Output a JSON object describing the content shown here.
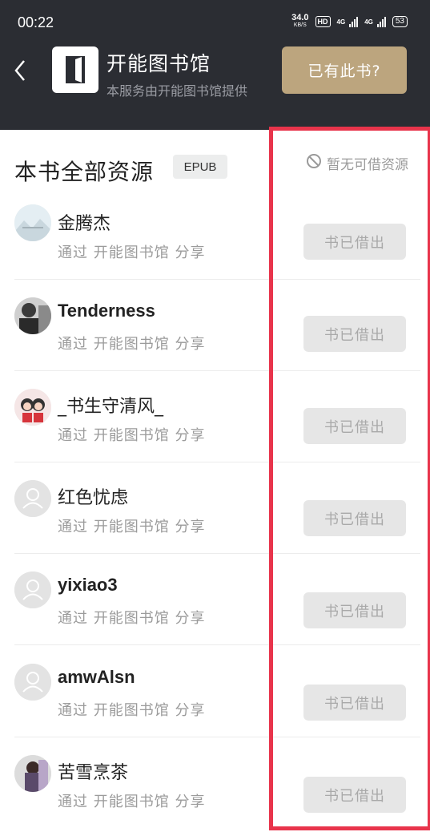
{
  "status": {
    "time": "00:22",
    "speed_value": "34.0",
    "speed_unit": "KB/S",
    "hd": "HD",
    "net1": "4G",
    "net2": "4G",
    "battery": "53"
  },
  "header": {
    "library_name": "开能图书馆",
    "subtitle": "本服务由开能图书馆提供",
    "have_book_button": "已有此书?"
  },
  "resources": {
    "title": "本书全部资源",
    "format": "EPUB",
    "no_resource_text": "暂无可借资源",
    "items": [
      {
        "name": "金腾杰",
        "via": "通过 开能图书馆 分享",
        "action": "书已借出",
        "avatar": "landscape-avatar"
      },
      {
        "name": "Tenderness",
        "via": "通过 开能图书馆 分享",
        "action": "书已借出",
        "avatar": "photo-avatar"
      },
      {
        "name": "_书生守清风_",
        "via": "通过 开能图书馆 分享",
        "action": "书已借出",
        "avatar": "cartoon-avatar"
      },
      {
        "name": "红色忧虑",
        "via": "通过 开能图书馆 分享",
        "action": "书已借出",
        "avatar": "default-avatar"
      },
      {
        "name": "yixiao3",
        "via": "通过 开能图书馆 分享",
        "action": "书已借出",
        "avatar": "default-avatar"
      },
      {
        "name": "amwAlsn",
        "via": "通过 开能图书馆 分享",
        "action": "书已借出",
        "avatar": "default-avatar"
      },
      {
        "name": "苦雪烹茶",
        "via": "通过 开能图书馆 分享",
        "action": "书已借出",
        "avatar": "photo-avatar"
      }
    ]
  },
  "colors": {
    "header_bg": "#2b2d33",
    "accent_gold": "#bca57e",
    "highlight_red": "#e8344b",
    "disabled_gray": "#e6e6e6"
  }
}
